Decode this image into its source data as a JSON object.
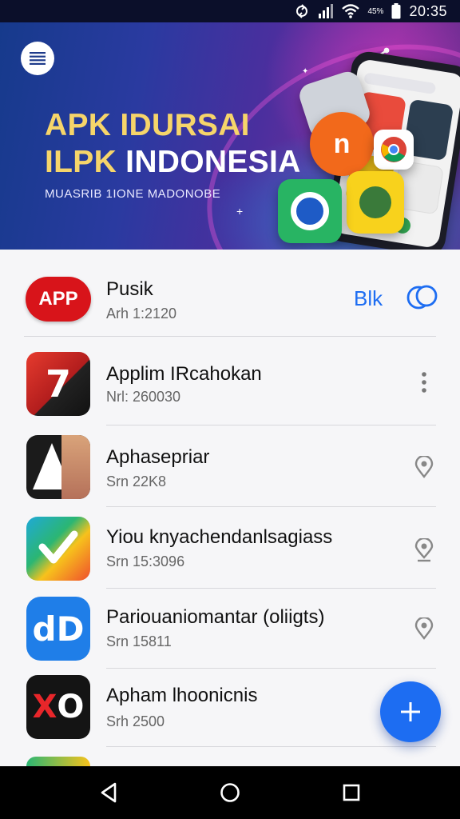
{
  "status_bar": {
    "time": "20:35",
    "battery_percent": "45%",
    "icons": [
      "sync-icon",
      "signal-icon",
      "wifi-icon",
      "battery-icon"
    ]
  },
  "banner": {
    "title_line1": "APK IDURSAI",
    "title_line2_prefix": "ILPK",
    "title_line2_rest": " INDONESIA",
    "subtitle": "MUASRIB 1IONE MADONOBE"
  },
  "featured": {
    "icon_text": "APP",
    "name": "Pusik",
    "sub": "Arh 1:2120",
    "action_label": "Blk"
  },
  "apps": [
    {
      "name": "Applim IRcahokan",
      "sub": "Nrl: 260030",
      "trail": "more"
    },
    {
      "name": "Aphasepriar",
      "sub": "Srn 22K8",
      "trail": "pin"
    },
    {
      "name": "Yiou knyachendanlsagiass",
      "sub": "Srn 15:3096",
      "trail": "pin"
    },
    {
      "name": "Pariouaniomantar (oliigts)",
      "sub": "Srn 15811",
      "trail": "pin"
    },
    {
      "name": "Apham lhoonicnis",
      "sub": "Srh 2500",
      "trail": "none"
    }
  ],
  "colors": {
    "accent": "#1d6df2",
    "banner_gold": "#f6d56a",
    "status_bar": "#0b0f2a",
    "featured_red": "#d8141a"
  }
}
